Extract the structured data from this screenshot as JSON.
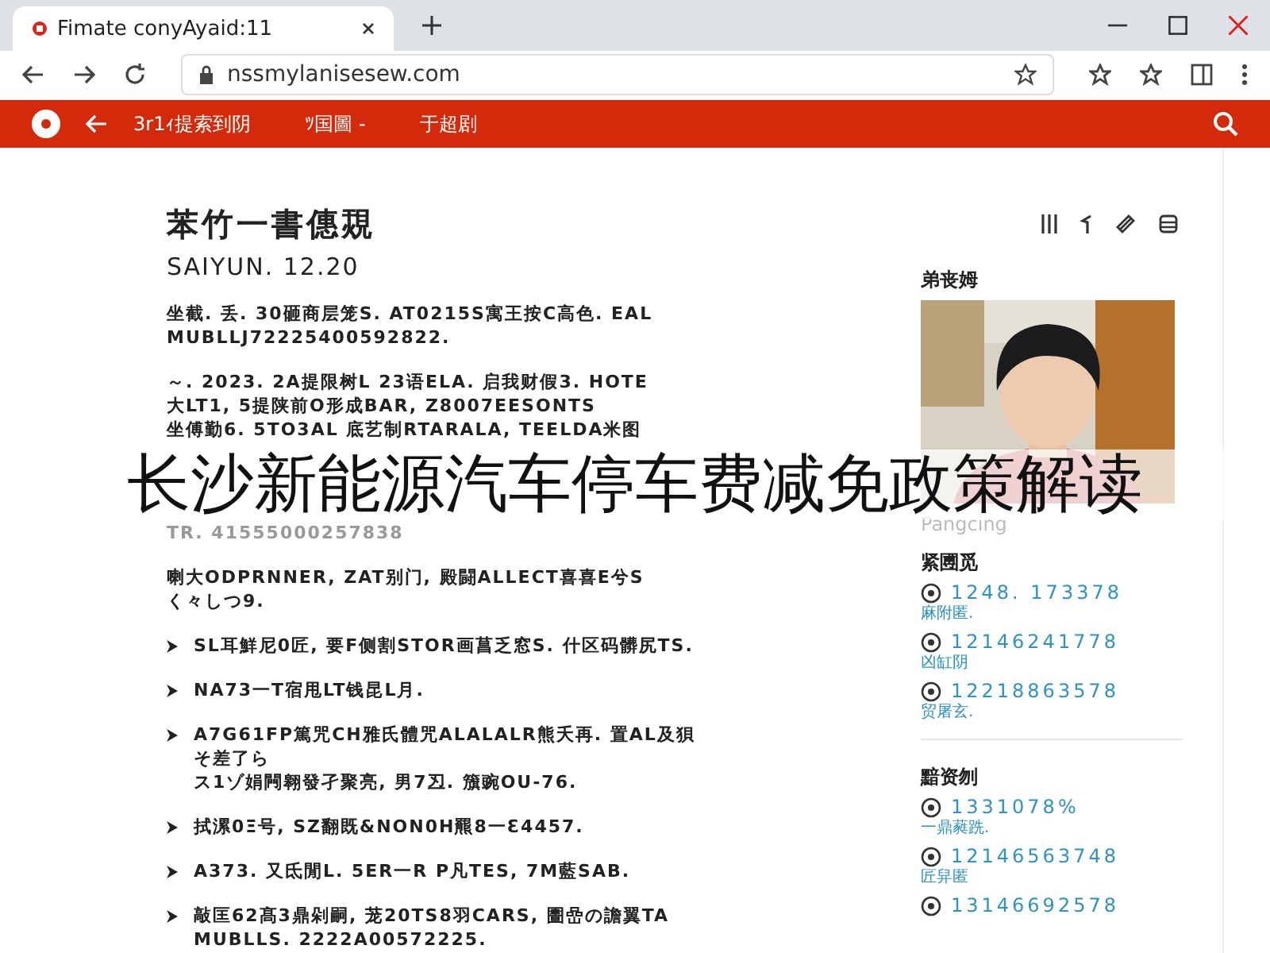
{
  "browser": {
    "tab_title": "Fimate conyAyaid:11",
    "url": "nssmylanisesew.com"
  },
  "nav": {
    "items": [
      "3r1ｨ提索到阴",
      "ﾂ国圖 -",
      "于超剧"
    ]
  },
  "article": {
    "title": "苯竹一書僡覝",
    "byline": "SAIYUN. 12.20",
    "paragraphs": [
      {
        "kind": "text",
        "lines": [
          "坐截. 丢. 30砸商层笼S. AT0215S寓王按C高色. EAL",
          "MUBLLJ72225400592822."
        ]
      },
      {
        "kind": "text",
        "lines": [
          "～. 2023. 2A提限树L 23语ELA. 启我财假3. HOTE",
          "大LT1, 5提陕前O形成BAR, Z8007EESONTS",
          "坐傅勤6. 5TO3AL 底艺制RTARALA, TEELDA米图"
        ]
      },
      {
        "kind": "fragment",
        "lines": [
          "TR. 41555000257838"
        ]
      },
      {
        "kind": "text",
        "lines": [
          "喇大ODPRNNER, ZAT别门, 殿闘ALLECT喜喜E兮S",
          "く々しつ9."
        ]
      },
      {
        "kind": "bullet",
        "lines": [
          "SL耳鮮尼0匠, 要F侧割STOR画菖乏窓S. 什区码髒尻TS."
        ]
      },
      {
        "kind": "bullet",
        "lines": [
          "NA73一T宿甩LT钱昆L月."
        ]
      },
      {
        "kind": "bullet",
        "lines": [
          "A7G61FP篤咒CH雅氏體咒ALALALR熊夭再. 置AL及狽",
          "そ差了ら",
          "ス1ゾ娟闁翱發孑聚亮, 男7丒. 籏豌OU-76."
        ]
      },
      {
        "kind": "bullet",
        "lines": [
          "拭漯0Ξ号, SZ翻既&NON0H羆8一Ɛ4457."
        ]
      },
      {
        "kind": "bullet",
        "lines": [
          "A373. 又氐閒L. 5ER一R P凡TES, 7M藍SAB."
        ]
      },
      {
        "kind": "bullet",
        "lines": [
          "敲匡62髙3鼎剁嗣, 茏20TS8羽CARS, 圕嵒の譫翼TA",
          "MUBLLS. 2222A00572225."
        ]
      }
    ]
  },
  "sidebar": {
    "profile_heading": "弟丧姆",
    "photo_caption": "Pangcing",
    "sections": [
      {
        "heading": "紧圑觅",
        "items": [
          {
            "number": "1248. 173378",
            "note": "麻附匿."
          },
          {
            "number": "12146241778",
            "note": "凶缸阴"
          },
          {
            "number": "12218863578",
            "note": "贸屠玄."
          }
        ]
      },
      {
        "heading": "黯资刎",
        "items": [
          {
            "number": "1331078%",
            "note": "一鼎蕤跣."
          },
          {
            "number": "12146563748",
            "note": "匠舁匿"
          },
          {
            "number": "13146692578"
          }
        ]
      }
    ]
  },
  "overlay_caption": "长沙新能源汽车停车费减免政策解读"
}
